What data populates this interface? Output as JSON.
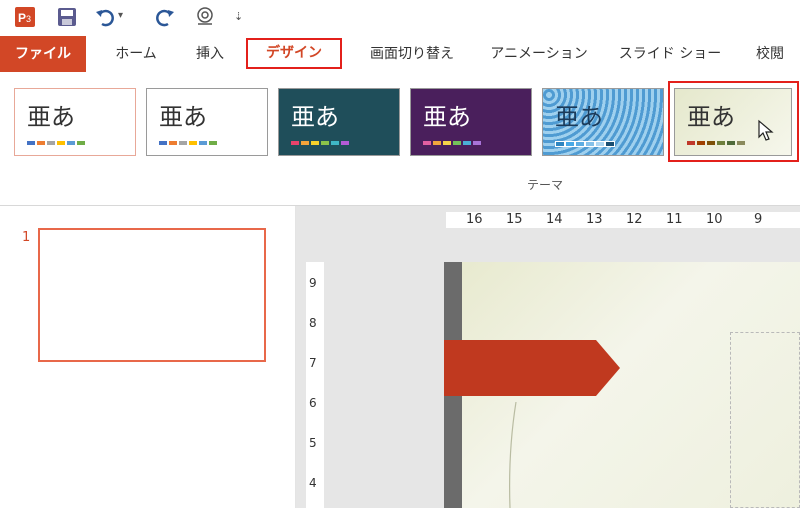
{
  "qat": {
    "icons": [
      "powerpoint-icon",
      "save-icon",
      "undo-icon",
      "redo-icon",
      "touch-mode-icon",
      "customize-icon"
    ],
    "undo_caret": "▾",
    "customize_caret": "⇣"
  },
  "tabs": {
    "file": "ファイル",
    "home": "ホーム",
    "insert": "挿入",
    "design": "デザイン",
    "transitions": "画面切り替え",
    "animations": "アニメーション",
    "slideshow": "スライド ショー",
    "review": "校閲"
  },
  "ribbon": {
    "group_label": "テーマ",
    "themes": [
      {
        "text": "亜あ",
        "bg": "#ffffff",
        "fg": "#333333",
        "colors": [
          "#4472c4",
          "#ed7d31",
          "#a5a5a5",
          "#ffc000",
          "#5b9bd5",
          "#70ad47"
        ]
      },
      {
        "text": "亜あ",
        "bg": "#ffffff",
        "fg": "#333333",
        "colors": [
          "#4472c4",
          "#ed7d31",
          "#a5a5a5",
          "#ffc000",
          "#5b9bd5",
          "#70ad47"
        ]
      },
      {
        "text": "亜あ",
        "bg": "#1f4e5a",
        "fg": "#ffffff",
        "colors": [
          "#e8436b",
          "#f3a33a",
          "#f6d12b",
          "#8bc34a",
          "#3fb6c6",
          "#b35bd6"
        ]
      },
      {
        "text": "亜あ",
        "bg": "#4a1f5c",
        "fg": "#ffffff",
        "colors": [
          "#e15fa1",
          "#f0a63d",
          "#f5d44a",
          "#74c35a",
          "#4bb0d6",
          "#a873d8"
        ]
      },
      {
        "text": "亜あ",
        "bg": "#5aa6d8",
        "fg": "#1b3b5a",
        "colors": [
          "#2e86c1",
          "#48a9e6",
          "#5dade2",
          "#85c1e9",
          "#aed6f1",
          "#1b4f72"
        ]
      },
      {
        "text": "亜あ",
        "bg": "#eef0de",
        "fg": "#333333",
        "colors": [
          "#c0392b",
          "#a04000",
          "#7e5109",
          "#6e7f3c",
          "#4f6b3a",
          "#8a8a5c"
        ]
      }
    ]
  },
  "slides_pane": {
    "slide_number": "1"
  },
  "rulers": {
    "horizontal": [
      "16",
      "15",
      "14",
      "13",
      "12",
      "11",
      "10",
      "9"
    ],
    "vertical": [
      "9",
      "8",
      "7",
      "6",
      "5",
      "4"
    ]
  },
  "colors": {
    "accent": "#d24726",
    "highlight_border": "#e3201b"
  }
}
